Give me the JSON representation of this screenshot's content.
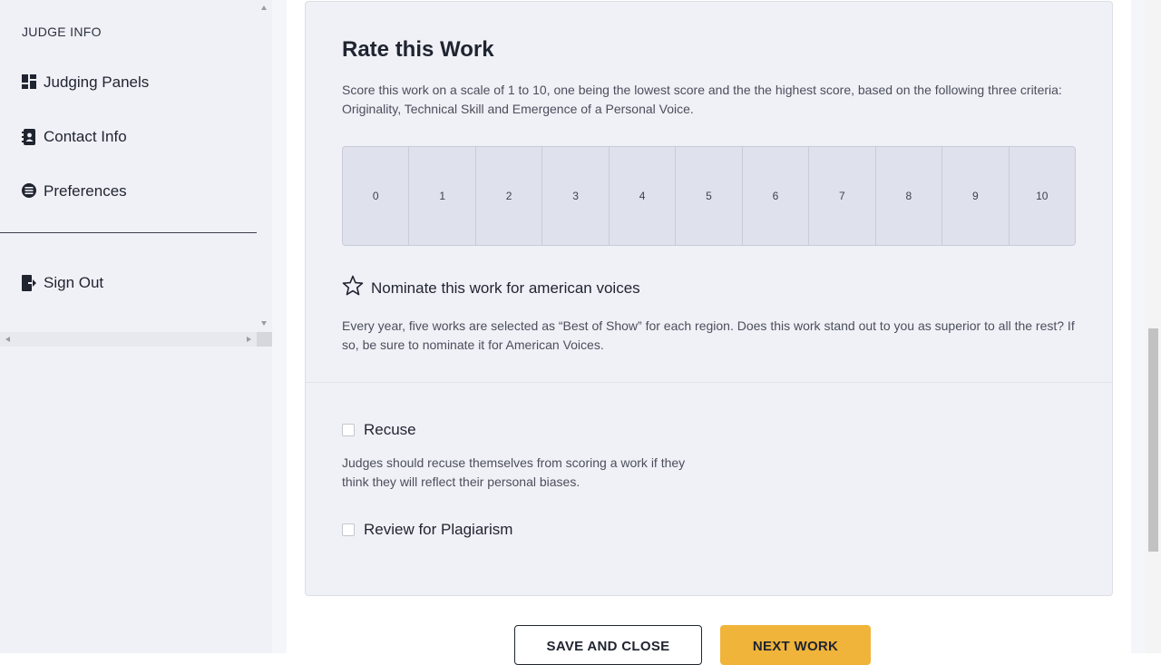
{
  "sidebar": {
    "section_label": "JUDGE INFO",
    "items": [
      {
        "label": "Judging Panels",
        "icon": "dashboard-icon"
      },
      {
        "label": "Contact Info",
        "icon": "contact-book-icon"
      },
      {
        "label": "Preferences",
        "icon": "preferences-icon"
      }
    ],
    "sign_out": {
      "label": "Sign Out",
      "icon": "sign-out-icon"
    }
  },
  "rating": {
    "title": "Rate this Work",
    "description": "Score this work on a scale of 1 to 10, one being the lowest score and the the highest score, based on the following three criteria: Originality, Technical Skill and Emergence of a Personal Voice.",
    "scores": [
      "0",
      "1",
      "2",
      "3",
      "4",
      "5",
      "6",
      "7",
      "8",
      "9",
      "10"
    ]
  },
  "nominate": {
    "label": "Nominate this work for american voices",
    "icon": "star-outline-icon",
    "description": "Every year, five works are selected as “Best of Show” for each region. Does this work stand out to you as superior to all the rest? If so, be sure to nominate it for American Voices."
  },
  "recuse": {
    "label": "Recuse",
    "checked": false,
    "description": "Judges should recuse themselves from scoring a work if they think they will reflect their personal biases."
  },
  "plagiarism": {
    "label": "Review for Plagiarism",
    "checked": false
  },
  "actions": {
    "save_label": "SAVE AND CLOSE",
    "next_label": "NEXT WORK"
  },
  "colors": {
    "accent": "#f0b43a",
    "card_bg": "#f0f1f6",
    "score_bg": "#dfe2ec"
  }
}
